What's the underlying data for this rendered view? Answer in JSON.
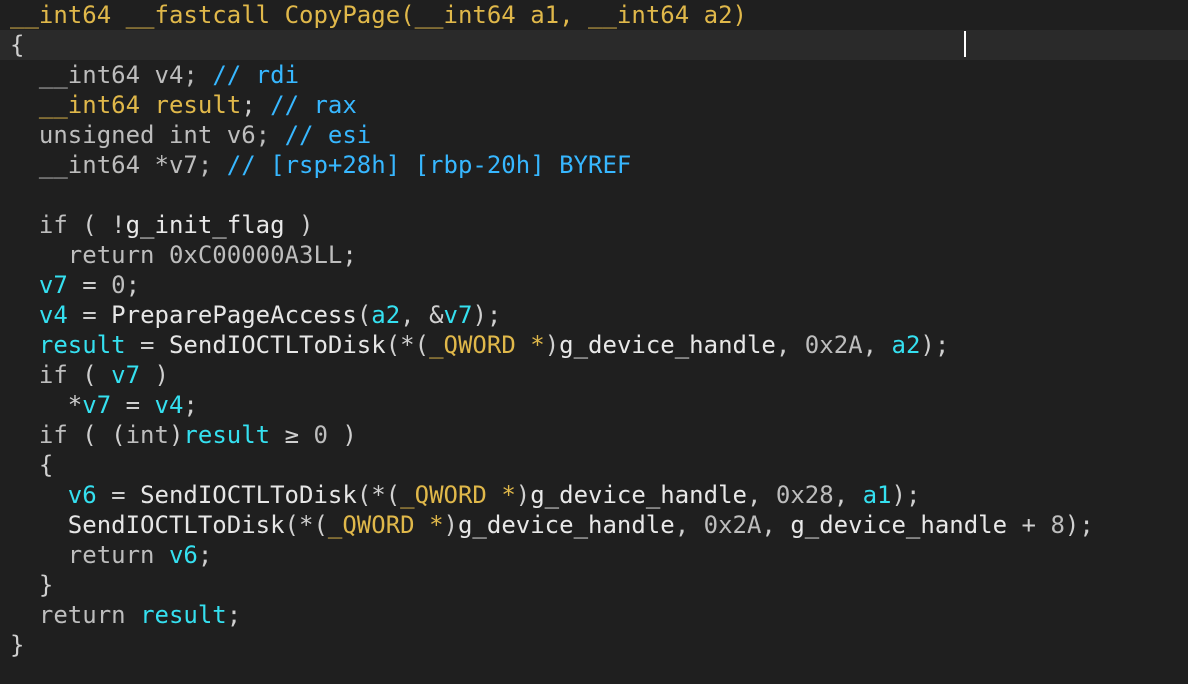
{
  "editor": {
    "colors": {
      "background": "#1f1f1f",
      "current_line": "#2a2a2a",
      "keyword": "#bdbdbd",
      "type": "#e0b84a",
      "function": "#e6e6e6",
      "variable": "#35e0f0",
      "global": "#e8e8e8",
      "comment": "#37b7ff",
      "number": "#bdbdbd"
    },
    "current_line_index": 1,
    "lines": [
      [
        [
          "type",
          "__int64"
        ],
        [
          "op",
          " "
        ],
        [
          "type",
          "__fastcall"
        ],
        [
          "op",
          " "
        ],
        [
          "type",
          "CopyPage("
        ],
        [
          "type",
          "__int64"
        ],
        [
          "type",
          " a1, "
        ],
        [
          "type",
          "__int64"
        ],
        [
          "type",
          " a2)"
        ]
      ],
      [
        [
          "op",
          "{"
        ]
      ],
      [
        [
          "op",
          "  "
        ],
        [
          "kw",
          "__int64"
        ],
        [
          "op",
          " "
        ],
        [
          "kw",
          "v4;"
        ],
        [
          "op",
          " "
        ],
        [
          "cmt",
          "// rdi"
        ]
      ],
      [
        [
          "op",
          "  "
        ],
        [
          "type",
          "__int64"
        ],
        [
          "op",
          " "
        ],
        [
          "type",
          "result"
        ],
        [
          "op",
          "; "
        ],
        [
          "cmt",
          "// rax"
        ]
      ],
      [
        [
          "op",
          "  "
        ],
        [
          "kw",
          "unsigned int"
        ],
        [
          "op",
          " "
        ],
        [
          "kw",
          "v6;"
        ],
        [
          "op",
          " "
        ],
        [
          "cmt",
          "// esi"
        ]
      ],
      [
        [
          "op",
          "  "
        ],
        [
          "kw",
          "__int64"
        ],
        [
          "op",
          " "
        ],
        [
          "kw",
          "*v7;"
        ],
        [
          "op",
          " "
        ],
        [
          "cmt",
          "// [rsp+28h] [rbp-20h] BYREF"
        ]
      ],
      [],
      [
        [
          "op",
          "  "
        ],
        [
          "kw",
          "if"
        ],
        [
          "op",
          " ( !"
        ],
        [
          "glob",
          "g_init_flag"
        ],
        [
          "op",
          " )"
        ]
      ],
      [
        [
          "op",
          "    "
        ],
        [
          "kw",
          "return"
        ],
        [
          "op",
          " "
        ],
        [
          "num",
          "0xC00000A3LL"
        ],
        [
          "op",
          ";"
        ]
      ],
      [
        [
          "op",
          "  "
        ],
        [
          "var",
          "v7"
        ],
        [
          "op",
          " = "
        ],
        [
          "num",
          "0"
        ],
        [
          "op",
          ";"
        ]
      ],
      [
        [
          "op",
          "  "
        ],
        [
          "var",
          "v4"
        ],
        [
          "op",
          " = "
        ],
        [
          "fn",
          "PreparePageAccess"
        ],
        [
          "op",
          "("
        ],
        [
          "var",
          "a2"
        ],
        [
          "op",
          ", &"
        ],
        [
          "var",
          "v7"
        ],
        [
          "op",
          ");"
        ]
      ],
      [
        [
          "op",
          "  "
        ],
        [
          "var",
          "result"
        ],
        [
          "op",
          " = "
        ],
        [
          "fn",
          "SendIOCTLToDisk"
        ],
        [
          "op",
          "(*("
        ],
        [
          "type",
          "_QWORD"
        ],
        [
          "op",
          " "
        ],
        [
          "type",
          "*"
        ],
        [
          "op",
          ")"
        ],
        [
          "glob",
          "g_device_handle"
        ],
        [
          "op",
          ", "
        ],
        [
          "num",
          "0x2A"
        ],
        [
          "op",
          ", "
        ],
        [
          "var",
          "a2"
        ],
        [
          "op",
          ");"
        ]
      ],
      [
        [
          "op",
          "  "
        ],
        [
          "kw",
          "if"
        ],
        [
          "op",
          " ( "
        ],
        [
          "var",
          "v7"
        ],
        [
          "op",
          " )"
        ]
      ],
      [
        [
          "op",
          "    *"
        ],
        [
          "var",
          "v7"
        ],
        [
          "op",
          " = "
        ],
        [
          "var",
          "v4"
        ],
        [
          "op",
          ";"
        ]
      ],
      [
        [
          "op",
          "  "
        ],
        [
          "kw",
          "if"
        ],
        [
          "op",
          " ( ("
        ],
        [
          "kw",
          "int"
        ],
        [
          "op",
          ")"
        ],
        [
          "var",
          "result"
        ],
        [
          "op",
          " ≥ "
        ],
        [
          "num",
          "0"
        ],
        [
          "op",
          " )"
        ]
      ],
      [
        [
          "op",
          "  {"
        ]
      ],
      [
        [
          "op",
          "    "
        ],
        [
          "var",
          "v6"
        ],
        [
          "op",
          " = "
        ],
        [
          "fn",
          "SendIOCTLToDisk"
        ],
        [
          "op",
          "(*("
        ],
        [
          "type",
          "_QWORD"
        ],
        [
          "op",
          " "
        ],
        [
          "type",
          "*"
        ],
        [
          "op",
          ")"
        ],
        [
          "glob",
          "g_device_handle"
        ],
        [
          "op",
          ", "
        ],
        [
          "num",
          "0x28"
        ],
        [
          "op",
          ", "
        ],
        [
          "var",
          "a1"
        ],
        [
          "op",
          ");"
        ]
      ],
      [
        [
          "op",
          "    "
        ],
        [
          "fn",
          "SendIOCTLToDisk"
        ],
        [
          "op",
          "(*("
        ],
        [
          "type",
          "_QWORD"
        ],
        [
          "op",
          " "
        ],
        [
          "type",
          "*"
        ],
        [
          "op",
          ")"
        ],
        [
          "glob",
          "g_device_handle"
        ],
        [
          "op",
          ", "
        ],
        [
          "num",
          "0x2A"
        ],
        [
          "op",
          ", "
        ],
        [
          "glob",
          "g_device_handle"
        ],
        [
          "op",
          " + "
        ],
        [
          "num",
          "8"
        ],
        [
          "op",
          ");"
        ]
      ],
      [
        [
          "op",
          "    "
        ],
        [
          "kw",
          "return"
        ],
        [
          "op",
          " "
        ],
        [
          "var",
          "v6"
        ],
        [
          "op",
          ";"
        ]
      ],
      [
        [
          "op",
          "  }"
        ]
      ],
      [
        [
          "op",
          "  "
        ],
        [
          "kw",
          "return"
        ],
        [
          "op",
          " "
        ],
        [
          "var",
          "result"
        ],
        [
          "op",
          ";"
        ]
      ],
      [
        [
          "op",
          "}"
        ]
      ]
    ]
  }
}
